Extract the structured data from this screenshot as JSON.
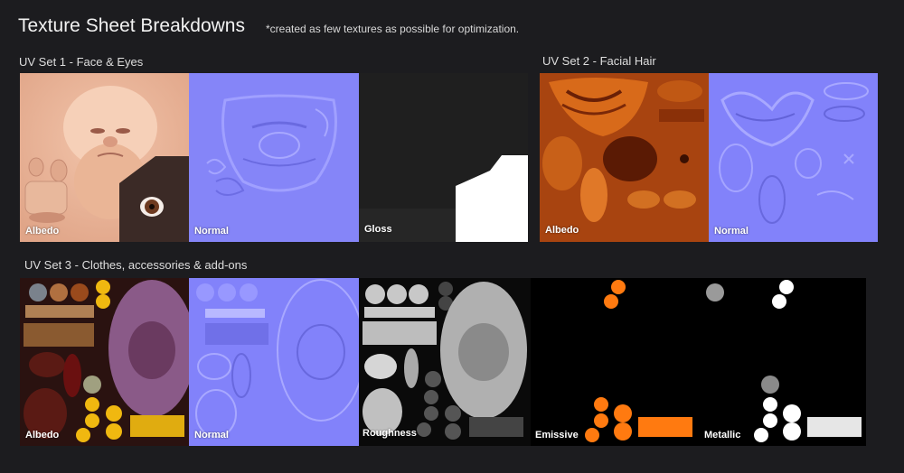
{
  "header": {
    "title": "Texture Sheet Breakdowns",
    "note": "*created as few textures as possible for optimization."
  },
  "sections": {
    "uv1": {
      "title": "UV Set 1 - Face & Eyes",
      "maps": [
        "Albedo",
        "Normal",
        "Gloss"
      ]
    },
    "uv2": {
      "title": "UV Set 2 - Facial Hair",
      "maps": [
        "Albedo",
        "Normal"
      ]
    },
    "uv3": {
      "title": "UV Set 3 - Clothes, accessories & add-ons",
      "maps": [
        "Albedo",
        "Normal",
        "Roughness",
        "Emissive",
        "Metallic"
      ]
    }
  },
  "colors": {
    "background": "#1c1c1f",
    "normal_map": "#8080ff",
    "emissive": "#ff7a10",
    "skin": "#e6b096",
    "hair": "#a8420c"
  }
}
